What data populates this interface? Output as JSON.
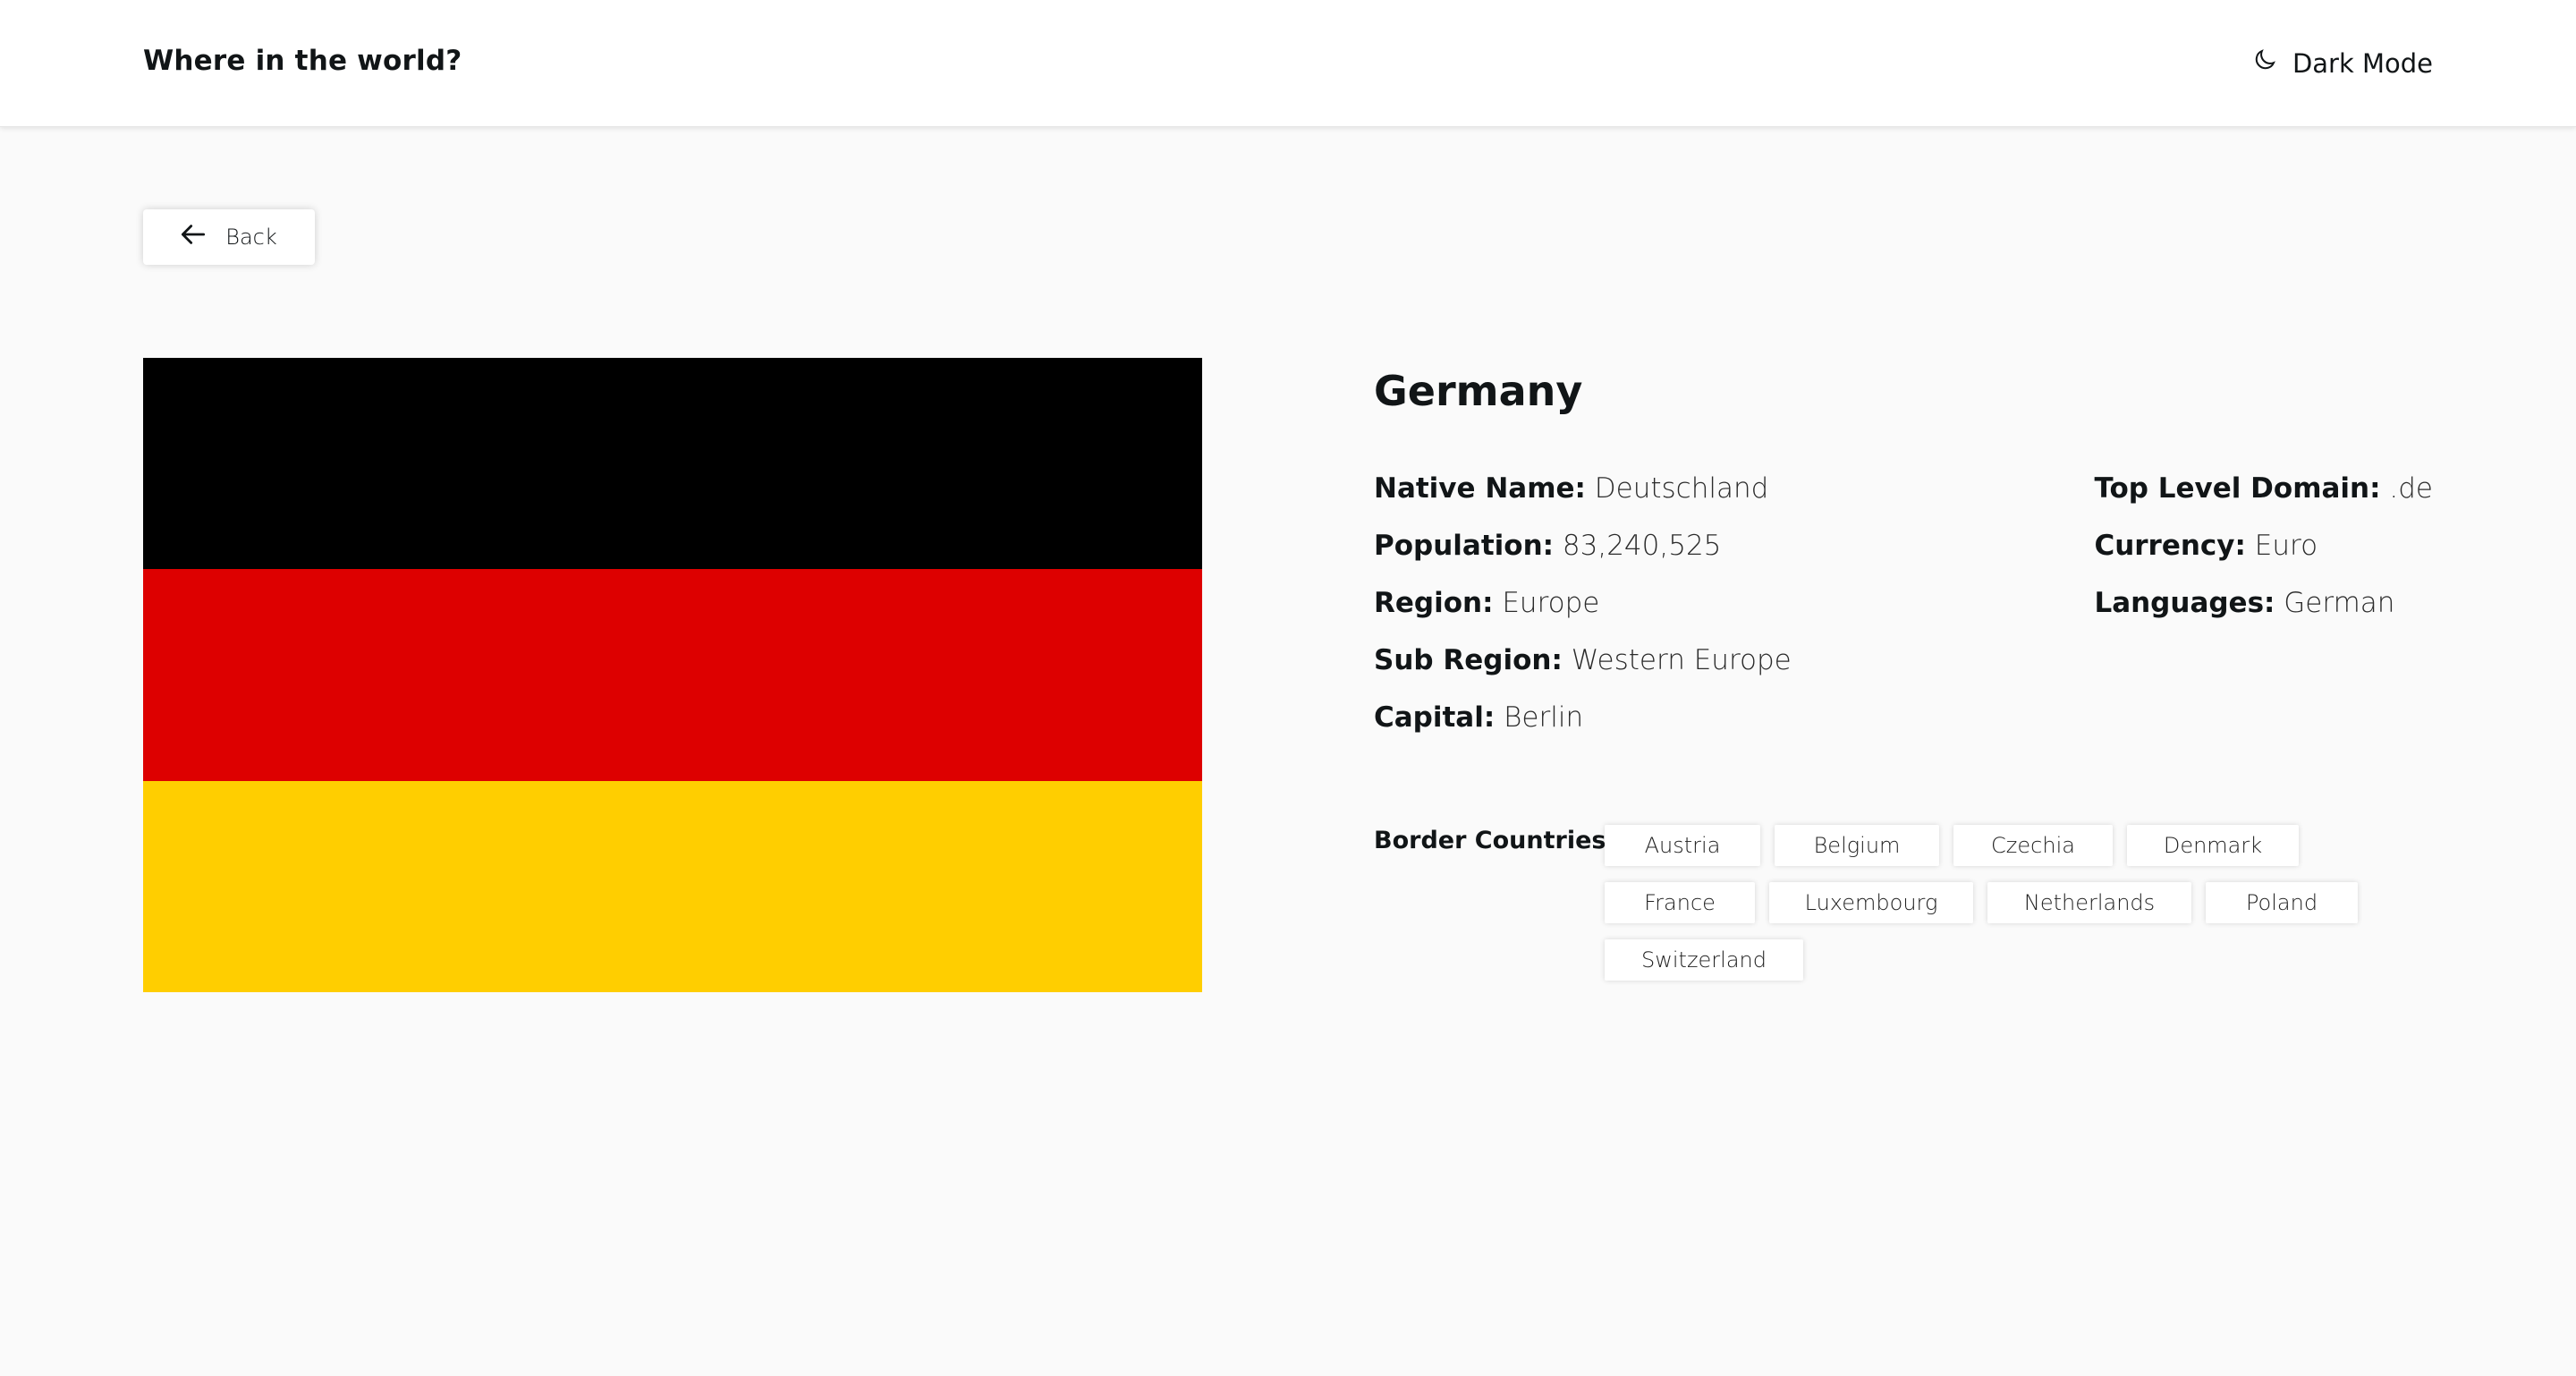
{
  "header": {
    "title": "Where in the world?",
    "theme_toggle": {
      "label": "Dark Mode",
      "icon": "moon-icon"
    }
  },
  "back_button": {
    "label": "Back",
    "icon": "arrow-left-icon"
  },
  "flag": {
    "colors": [
      "#000000",
      "#dd0000",
      "#ffce00"
    ]
  },
  "country": {
    "name": "Germany",
    "details_left": [
      {
        "label": "Native Name:",
        "value": "Deutschland"
      },
      {
        "label": "Population:",
        "value": "83,240,525"
      },
      {
        "label": "Region:",
        "value": "Europe"
      },
      {
        "label": "Sub Region:",
        "value": "Western Europe"
      },
      {
        "label": "Capital:",
        "value": "Berlin"
      }
    ],
    "details_right": [
      {
        "label": "Top Level Domain:",
        "value": ".de"
      },
      {
        "label": "Currency:",
        "value": "Euro"
      },
      {
        "label": "Languages:",
        "value": "German"
      }
    ],
    "border_label": "Border Countries:",
    "border_countries": [
      "Austria",
      "Belgium",
      "Czechia",
      "Denmark",
      "France",
      "Luxembourg",
      "Netherlands",
      "Poland",
      "Switzerland"
    ]
  }
}
